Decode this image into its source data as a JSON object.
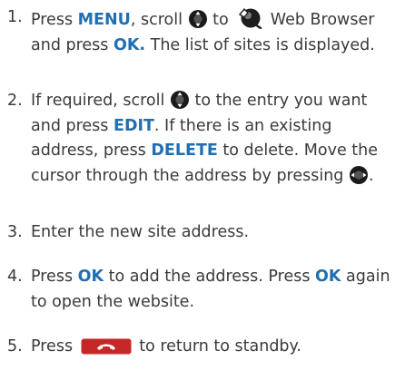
{
  "steps": [
    {
      "num": "1.",
      "t1": "Press ",
      "k1": "MENU",
      "t2": ", scroll ",
      "t3": " to ",
      "t4": " Web Browser and press ",
      "k2": "OK.",
      "t5": " The list of sites is displayed."
    },
    {
      "num": "2.",
      "t1": "If required, scroll ",
      "t2": " to the entry you want and press ",
      "k1": "EDIT",
      "t3": ". If there is an existing address, press ",
      "k2": "DELETE",
      "t4": " to delete. Move the cursor through the address by pressing ",
      "t5": "."
    },
    {
      "num": "3.",
      "t1": "Enter the new site address."
    },
    {
      "num": "4.",
      "t1": "Press ",
      "k1": "OK",
      "t2": " to add the address. Press ",
      "k2": "OK",
      "t3": " again to open the website."
    },
    {
      "num": "5.",
      "t1": "Press ",
      "t2": " to return to standby."
    }
  ],
  "colors": {
    "text": "#3a3a3a",
    "keyword": "#1f6fb2",
    "icon_dark": "#1a1a1a",
    "end_key": "#c62828"
  },
  "icons": {
    "nav_up_down": "nav-up-down-icon",
    "nav_left_right": "nav-left-right-icon",
    "browser": "web-browser-icon",
    "end_call": "end-call-key-icon"
  }
}
